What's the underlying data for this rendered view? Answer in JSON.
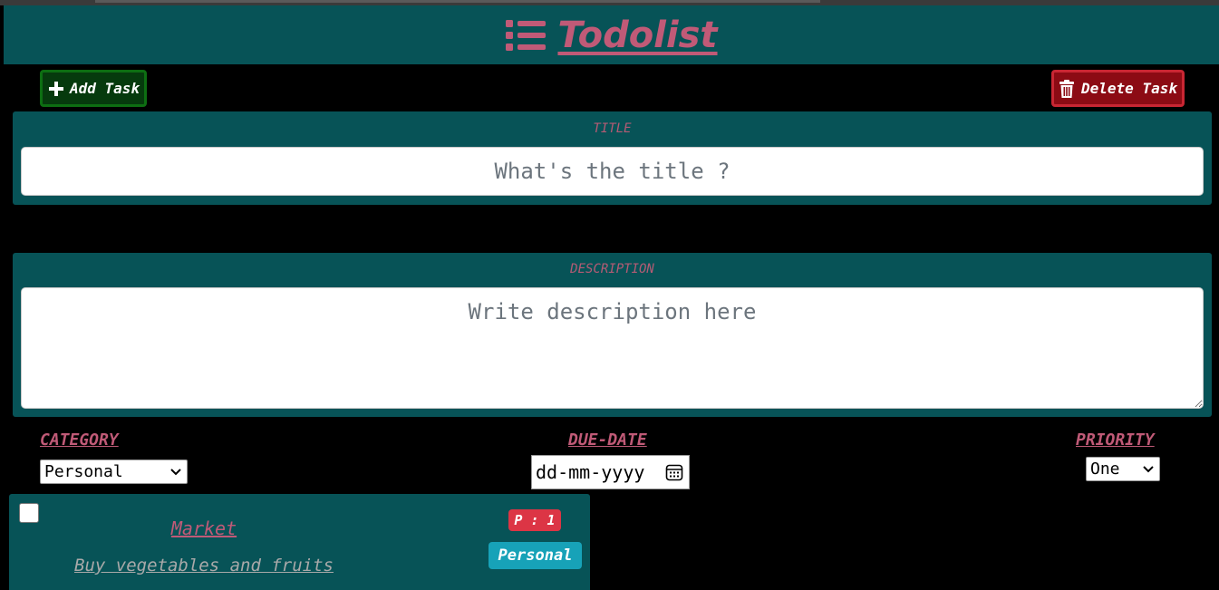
{
  "header": {
    "title": "Todolist",
    "icon": "list-icon"
  },
  "toolbar": {
    "add_label": "Add Task",
    "add_icon": "plus-icon",
    "delete_label": "Delete Task",
    "delete_icon": "trash-icon"
  },
  "form": {
    "title_label": "TITLE",
    "title_placeholder": "What's the title ?",
    "description_label": "DESCRIPTION",
    "description_placeholder": "Write description here",
    "category_label": "CATEGORY",
    "category_value": "Personal",
    "due_date_label": "DUE-DATE",
    "due_date_value": "dd-mm-yyyy",
    "priority_label": "PRIORITY",
    "priority_value": "One"
  },
  "tasks": [
    {
      "title": "Market",
      "description": "Buy vegetables and fruits",
      "priority_badge": "P : 1",
      "category_badge": "Personal",
      "checked": false
    }
  ],
  "colors": {
    "header_bg": "#075357",
    "accent": "#c05a77",
    "add_bg": "#063a0d",
    "delete_bg": "#8c0b14",
    "priority_badge": "#dc3545",
    "category_badge": "#17a2b8"
  }
}
